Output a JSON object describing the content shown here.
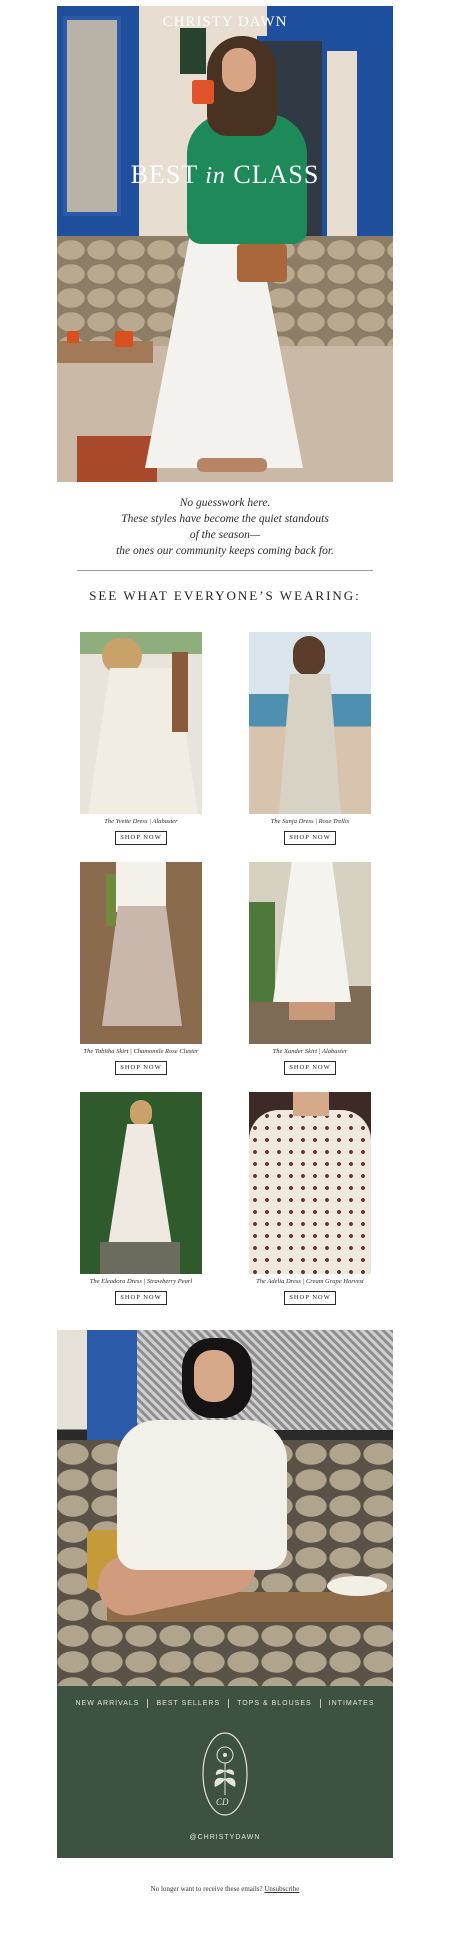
{
  "hero": {
    "brand": "CHRISTY DAWN",
    "headline_part1": "BEST",
    "headline_in": "in",
    "headline_part2": "CLASS"
  },
  "intro": {
    "lines": [
      "No guesswork here.",
      "These styles have become the quiet standouts",
      "of the season—",
      "the ones our community keeps coming back for."
    ]
  },
  "section_title": "SEE WHAT EVERYONE’S WEARING:",
  "products": [
    {
      "caption": "The Yvette Dress | Alabaster",
      "button": "SHOP NOW"
    },
    {
      "caption": "The Sanja Dress | Rose Trellis",
      "button": "SHOP NOW"
    },
    {
      "caption": "The Tabitha Skirt | Chamomile Rose Cluster",
      "button": "SHOP NOW"
    },
    {
      "caption": "The Xander Skirt | Alabaster",
      "button": "SHOP NOW"
    },
    {
      "caption": "The Eleadora Dress | Strawberry Pearl",
      "button": "SHOP NOW"
    },
    {
      "caption": "The Adelia Dress | Cream Grape Harvest",
      "button": "SHOP NOW"
    }
  ],
  "footer": {
    "nav": [
      "NEW ARRIVALS",
      "BEST SELLERS",
      "TOPS & BLOUSES",
      "INTIMATES"
    ],
    "logo_initials": "CD",
    "handle": "@CHRISTYDAWN"
  },
  "unsubscribe": {
    "text": "No longer want to receive these emails?",
    "link": "Unsubscribe"
  },
  "colors": {
    "footer_bg": "#3d5240",
    "footer_text": "#e6e3d6"
  }
}
